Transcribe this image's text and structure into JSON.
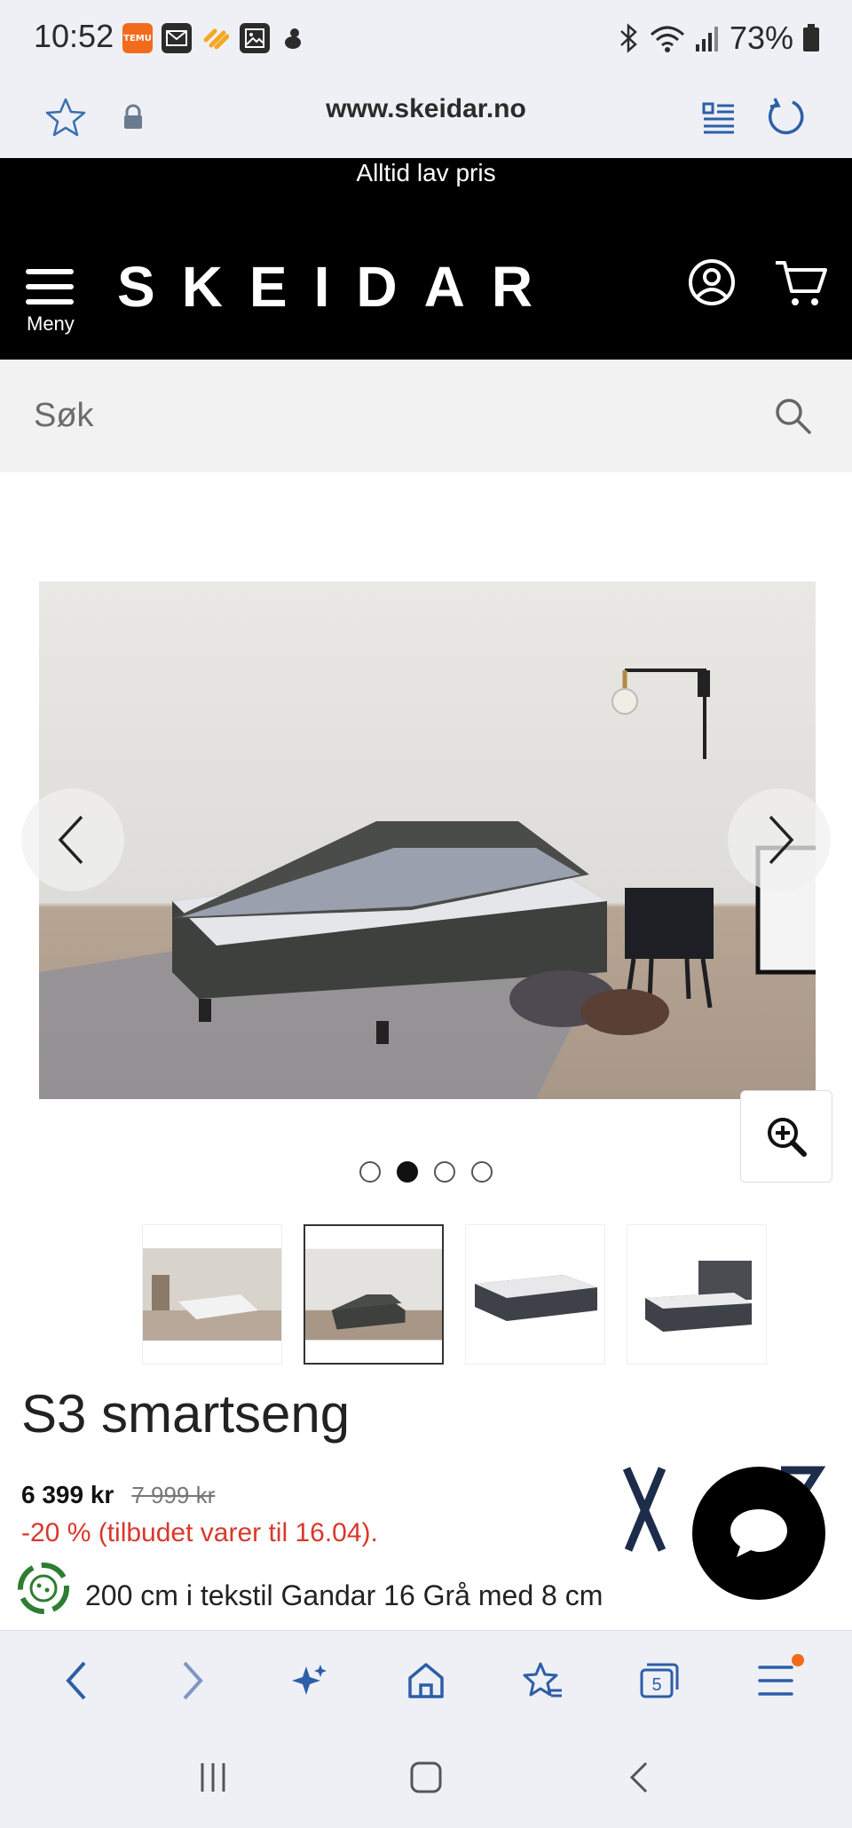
{
  "status_bar": {
    "time": "10:52",
    "apps": [
      "temu-icon",
      "mail-icon",
      "hearts-app-icon",
      "gallery-icon",
      "bird-app-icon"
    ],
    "battery": "73%"
  },
  "browser": {
    "url": "www.skeidar.no"
  },
  "site": {
    "promo": "Alltid lav pris",
    "logo": "SKEIDAR",
    "menu_label": "Meny",
    "search_placeholder": "Søk"
  },
  "product": {
    "title": "S3 smartseng",
    "price": "6 399 kr",
    "old_price": "7 999 kr",
    "discount": "-20 % (tilbudet varer til 16.04).",
    "description": "200 cm i tekstil Gandar 16 Grå med 8 cm",
    "active_image_index": 2,
    "image_count": 4
  },
  "colors": {
    "header_bg": "#000000",
    "discount": "#d9382c",
    "notification": "#f26b1d"
  }
}
